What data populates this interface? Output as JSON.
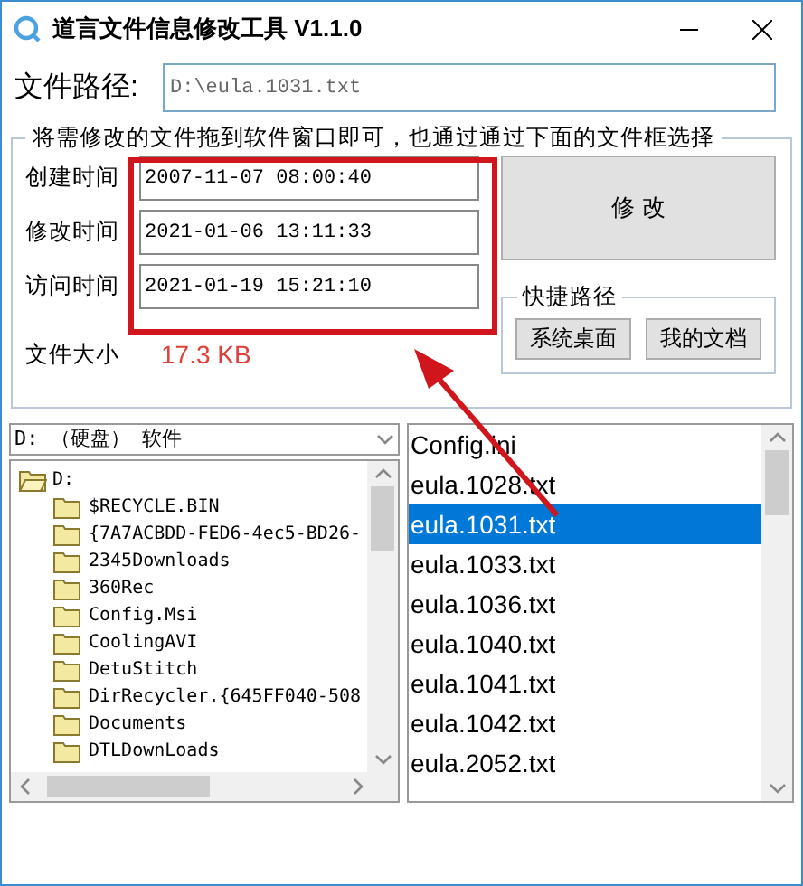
{
  "window": {
    "title": "道言文件信息修改工具 V1.1.0"
  },
  "path": {
    "label": "文件路径:",
    "value": "D:\\eula.1031.txt"
  },
  "group": {
    "caption": "将需修改的文件拖到软件窗口即可，也通过通过下面的文件框选择"
  },
  "times": [
    {
      "label": "创建时间",
      "value": "2007-11-07 08:00:40"
    },
    {
      "label": "修改时间",
      "value": "2021-01-06 13:11:33"
    },
    {
      "label": "访问时间",
      "value": "2021-01-19 15:21:10"
    }
  ],
  "modify_button": "修 改",
  "size": {
    "label": "文件大小",
    "value": "17.3 KB"
  },
  "shortcuts": {
    "caption": "快捷路径",
    "buttons": [
      "系统桌面",
      "我的文档"
    ]
  },
  "drive": {
    "value": "D: （硬盘） 软件"
  },
  "tree": {
    "label": "D:",
    "expanded": true,
    "children": [
      {
        "label": "$RECYCLE.BIN"
      },
      {
        "label": "{7A7ACBDD-FED6-4ec5-BD26-"
      },
      {
        "label": "2345Downloads"
      },
      {
        "label": "360Rec"
      },
      {
        "label": "Config.Msi"
      },
      {
        "label": "CoolingAVI"
      },
      {
        "label": "DetuStitch"
      },
      {
        "label": "DirRecycler.{645FF040-508"
      },
      {
        "label": "Documents"
      },
      {
        "label": "DTLDownLoads"
      }
    ]
  },
  "files": [
    {
      "name": "Config.ini",
      "selected": false
    },
    {
      "name": "eula.1028.txt",
      "selected": false
    },
    {
      "name": "eula.1031.txt",
      "selected": true
    },
    {
      "name": "eula.1033.txt",
      "selected": false
    },
    {
      "name": "eula.1036.txt",
      "selected": false
    },
    {
      "name": "eula.1040.txt",
      "selected": false
    },
    {
      "name": "eula.1041.txt",
      "selected": false
    },
    {
      "name": "eula.1042.txt",
      "selected": false
    },
    {
      "name": "eula.2052.txt",
      "selected": false
    }
  ]
}
